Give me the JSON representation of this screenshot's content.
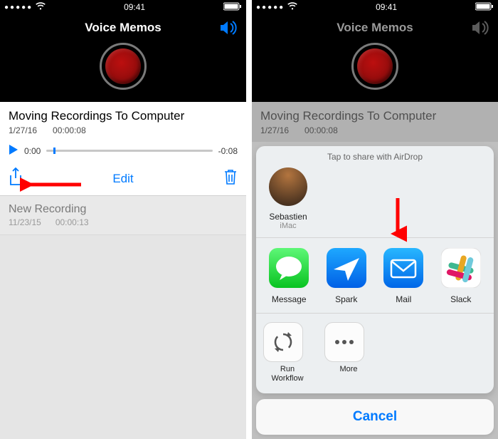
{
  "status": {
    "time": "09:41"
  },
  "header": {
    "title": "Voice Memos"
  },
  "current": {
    "title": "Moving Recordings To Computer",
    "date": "1/27/16",
    "duration": "00:00:08",
    "elapsed": "0:00",
    "remaining": "-0:08",
    "edit_label": "Edit"
  },
  "list": {
    "items": [
      {
        "title": "New Recording",
        "date": "11/23/15",
        "duration": "00:00:13"
      }
    ]
  },
  "share_sheet": {
    "airdrop_hint": "Tap to share with AirDrop",
    "contacts": [
      {
        "name": "Sebastien",
        "device": "iMac"
      }
    ],
    "apps": [
      {
        "label": "Message",
        "id": "messages",
        "bg": "#25d366"
      },
      {
        "label": "Spark",
        "id": "spark",
        "bg": "#0a84ff"
      },
      {
        "label": "Mail",
        "id": "mail",
        "bg": "#1b90ff"
      },
      {
        "label": "Slack",
        "id": "slack",
        "bg": "#ffffff"
      }
    ],
    "actions": [
      {
        "label": "Run Workflow",
        "icon": "workflow"
      },
      {
        "label": "More",
        "icon": "more"
      }
    ],
    "cancel": "Cancel"
  }
}
